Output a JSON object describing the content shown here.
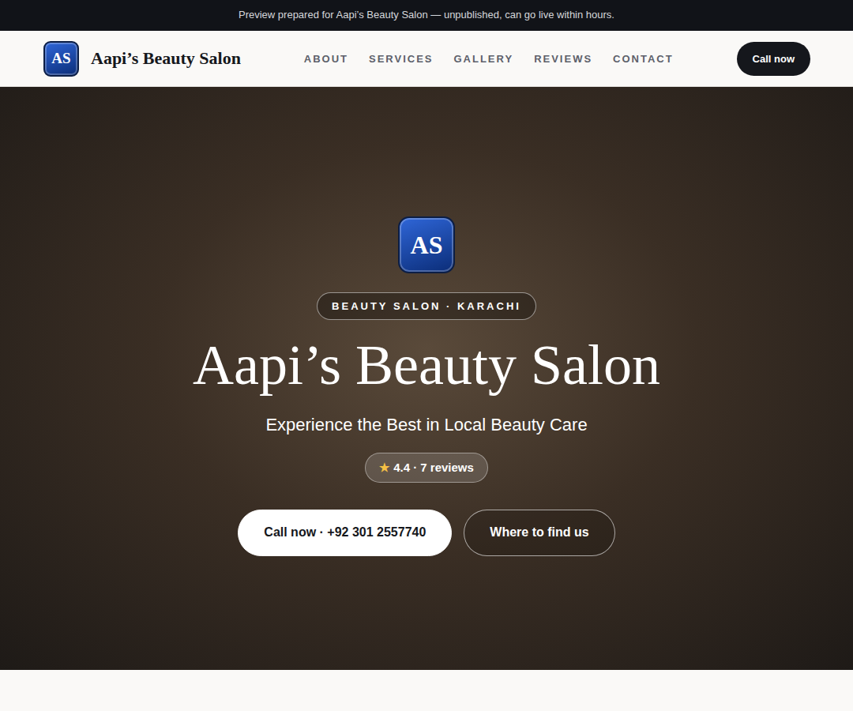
{
  "banner": {
    "text": "Preview prepared for Aapi’s Beauty Salon — unpublished, can go live within hours."
  },
  "nav": {
    "logo": "AS",
    "brand": "Aapi’s Beauty Salon",
    "links": [
      "ABOUT",
      "SERVICES",
      "GALLERY",
      "REVIEWS",
      "CONTACT"
    ],
    "cta": "Call now"
  },
  "hero": {
    "logo": "AS",
    "badge": "BEAUTY SALON · KARACHI",
    "title": "Aapi’s Beauty Salon",
    "subtitle": "Experience the Best in Local Beauty Care",
    "rating": {
      "star": "★",
      "text": "4.4 · 7 reviews"
    },
    "buttons": [
      {
        "label": "Call now · +92 301 2557740",
        "kind": "primary"
      },
      {
        "label": "Where to find us",
        "kind": "outline"
      }
    ]
  }
}
